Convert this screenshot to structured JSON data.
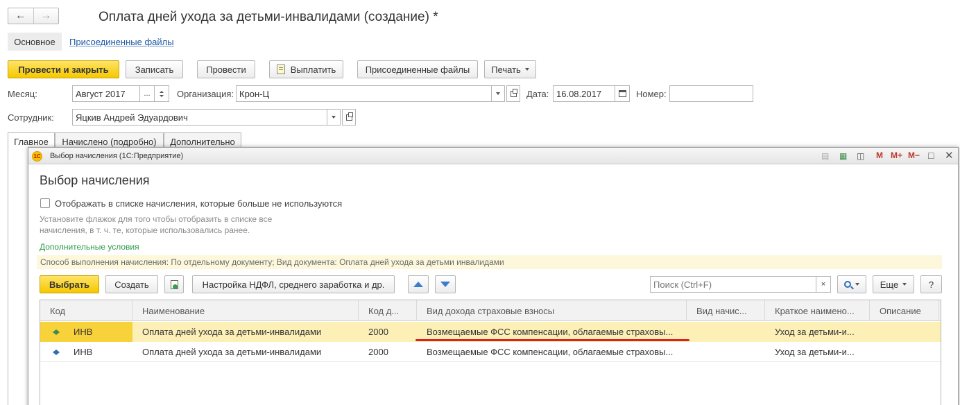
{
  "header": {
    "back_icon": "arrow-left-icon",
    "forward_icon": "arrow-right-icon",
    "title": "Оплата дней ухода за детьми-инвалидами (создание) *"
  },
  "top_tabs": {
    "main": "Основное",
    "files": "Присоединенные файлы"
  },
  "toolbar": {
    "post_close": "Провести и закрыть",
    "save": "Записать",
    "post": "Провести",
    "pay": "Выплатить",
    "attached": "Присоединенные файлы",
    "print": "Печать"
  },
  "form": {
    "month_label": "Месяц:",
    "month_value": "Август 2017",
    "month_dots": "...",
    "org_label": "Организация:",
    "org_value": "Крон-Ц",
    "date_label": "Дата:",
    "date_value": "16.08.2017",
    "number_label": "Номер:",
    "number_value": "",
    "employee_label": "Сотрудник:",
    "employee_value": "Яцкив Андрей Эдуардович"
  },
  "page_tabs": [
    "Главное",
    "Начислено (подробно)",
    "Дополнительно"
  ],
  "dialog": {
    "caption": "Выбор начисления  (1С:Предприятие)",
    "logo_text": "1С",
    "m_buttons": [
      "M",
      "M+",
      "M−"
    ],
    "title": "Выбор начисления",
    "checkbox_label": "Отображать в списке начисления, которые больше не используются",
    "hint": "Установите флажок для того чтобы отобразить в списке все начисления, в т. ч. те, которые использовались ранее.",
    "extra_conditions": "Дополнительные условия",
    "conditions_text": "Способ выполнения начисления: По отдельному документу; Вид документа: Оплата дней ухода за детьми инвалидами",
    "select_button": "Выбрать",
    "create_button": "Создать",
    "ndfl_button": "Настройка НДФЛ, среднего заработка и др.",
    "search_placeholder": "Поиск (Ctrl+F)",
    "clear_label": "×",
    "more_button": "Еще",
    "help_button": "?"
  },
  "grid": {
    "columns": [
      "Код",
      "Наименование",
      "Код д...",
      "Вид дохода страховые взносы",
      "Вид начис...",
      "Краткое наимено...",
      "Описание"
    ],
    "rows": [
      {
        "code": "ИНВ",
        "name": "Оплата дней ухода за детьми-инвалидами",
        "income_code": "2000",
        "income_type": "Возмещаемые ФСС компенсации, облагаемые страховы...",
        "accrual_type": "",
        "short_name": "Уход за детьми-и...",
        "description": ""
      },
      {
        "code": "ИНВ",
        "name": "Оплата дней ухода за детьми-инвалидами",
        "income_code": "2000",
        "income_type": "Возмещаемые ФСС компенсации, облагаемые страховы...",
        "accrual_type": "",
        "short_name": "Уход за детьми-и...",
        "description": ""
      }
    ]
  },
  "colors": {
    "accent_yellow": "#f5c800",
    "selected_row": "#fdf0b7",
    "link_blue": "#1f5aa6",
    "green_text": "#2d9b4a",
    "red_underline": "#e02020"
  }
}
